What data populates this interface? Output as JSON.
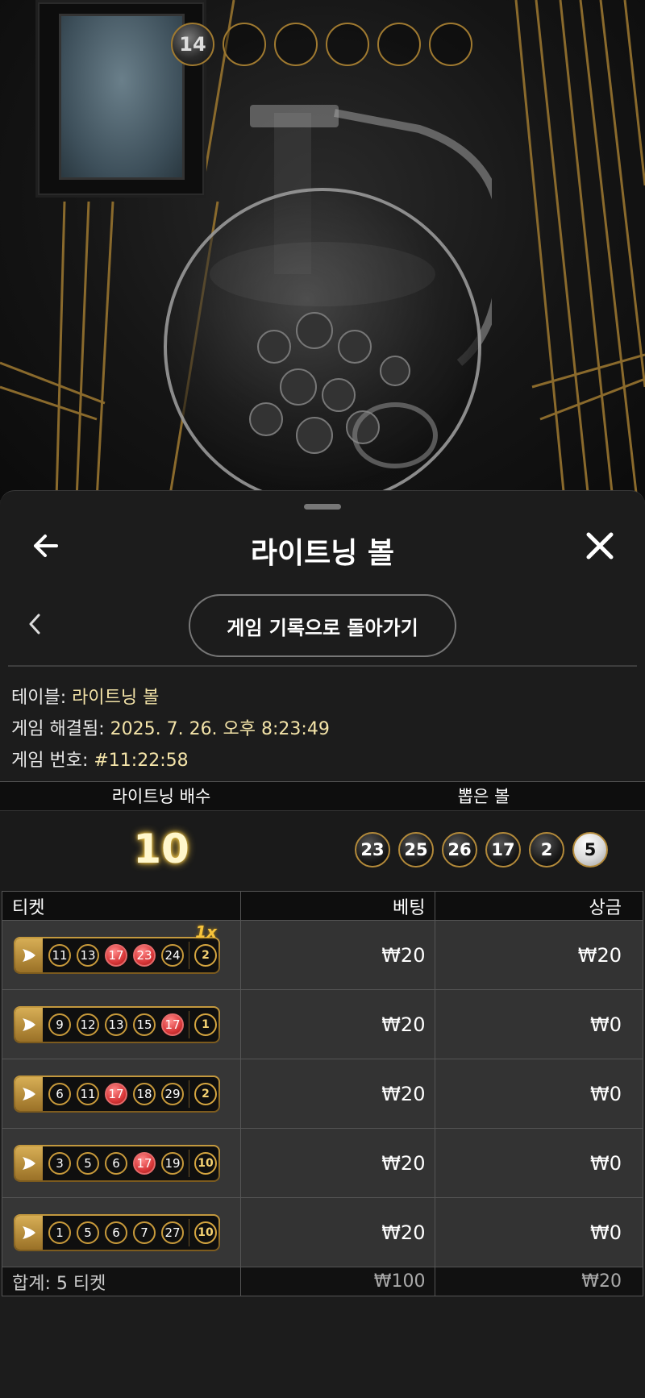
{
  "scene": {
    "drawn_slots": [
      "14",
      "",
      "",
      "",
      "",
      ""
    ]
  },
  "sheet": {
    "title": "라이트닝 볼",
    "history_button": "게임 기록으로 돌아가기"
  },
  "info": {
    "table_label": "테이블:",
    "table_value": "라이트닝 볼",
    "resolved_label": "게임 해결됨:",
    "resolved_value": "2025. 7. 26. 오후 8:23:49",
    "game_no_label": "게임 번호:",
    "game_no_value": "#11:22:58"
  },
  "lightning": {
    "mult_header": "라이트닝 배수",
    "drawn_header": "뽑은 볼",
    "multiplier": "10",
    "drawn_balls": [
      "23",
      "25",
      "26",
      "17",
      "2",
      "5"
    ],
    "white_ball_index": 5
  },
  "tickets": {
    "headers": {
      "ticket": "티켓",
      "bet": "베팅",
      "prize": "상금"
    },
    "rows": [
      {
        "numbers": [
          "11",
          "13",
          "17",
          "23",
          "24"
        ],
        "hits": [
          false,
          false,
          true,
          true,
          false
        ],
        "mult": "2",
        "badge": "1x",
        "bet": "₩20",
        "prize": "₩20"
      },
      {
        "numbers": [
          "9",
          "12",
          "13",
          "15",
          "17"
        ],
        "hits": [
          false,
          false,
          false,
          false,
          true
        ],
        "mult": "1",
        "badge": "",
        "bet": "₩20",
        "prize": "₩0"
      },
      {
        "numbers": [
          "6",
          "11",
          "17",
          "18",
          "29"
        ],
        "hits": [
          false,
          false,
          true,
          false,
          false
        ],
        "mult": "2",
        "badge": "",
        "bet": "₩20",
        "prize": "₩0"
      },
      {
        "numbers": [
          "3",
          "5",
          "6",
          "17",
          "19"
        ],
        "hits": [
          false,
          false,
          false,
          true,
          false
        ],
        "mult": "10",
        "badge": "",
        "bet": "₩20",
        "prize": "₩0"
      },
      {
        "numbers": [
          "1",
          "5",
          "6",
          "7",
          "27"
        ],
        "hits": [
          false,
          false,
          false,
          false,
          false
        ],
        "mult": "10",
        "badge": "",
        "bet": "₩20",
        "prize": "₩0"
      }
    ],
    "total": {
      "label": "합계: 5 티켓",
      "bet": "₩100",
      "prize": "₩20"
    }
  },
  "colors": {
    "gold": "#c89a3b",
    "hit_red": "#d9383a",
    "value_text": "#f3e3a8"
  }
}
